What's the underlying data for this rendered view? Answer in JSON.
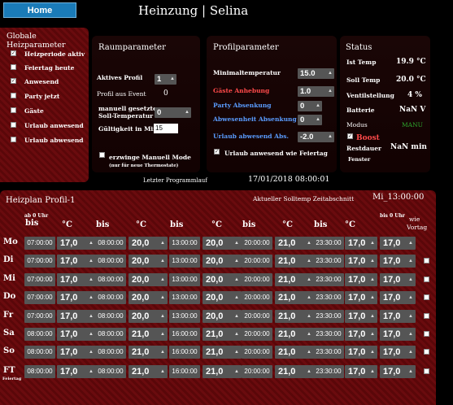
{
  "header": {
    "home_label": "Home",
    "title": "Heinzung | Selina"
  },
  "global": {
    "title": "Globale Heizparameter",
    "items": [
      {
        "label": "Heizperiode aktiv",
        "checked": true
      },
      {
        "label": "Feiertag heute",
        "checked": false
      },
      {
        "label": "Anwesend",
        "checked": true
      },
      {
        "label": "Party jetzt",
        "checked": false
      },
      {
        "label": "Gäste",
        "checked": false
      },
      {
        "label": "Urlaub anwesend",
        "checked": false
      },
      {
        "label": "Urlaub abwesend",
        "checked": false
      }
    ]
  },
  "room": {
    "title": "Raumparameter",
    "active_profile_label": "Aktives Profil",
    "active_profile_value": "1",
    "profile_event_label": "Profil aus Event",
    "profile_event_value": "0",
    "manual_label_1": "manuell gesetzte",
    "manual_label_2": "Soll-Temperatur",
    "manual_value": "0",
    "validity_label": "Gültigkeit in Min",
    "validity_value": "15",
    "force_label": "erzwinge Manuell Mode",
    "force_note": "(nur für neue Thermostate)",
    "last_run_label": "Letzter Programmlauf",
    "last_run_value": "17/01/2018 08:00:01"
  },
  "profile": {
    "title": "Profilparameter",
    "rows": [
      {
        "label": "Minimaltemperatur",
        "value": "15.0",
        "color": "#ffffff"
      },
      {
        "label": "Gäste Anhebung",
        "value": "1.0",
        "color": "#ff4a4a"
      },
      {
        "label": "Party Absenkung",
        "value": "0",
        "color": "#5a9cff"
      },
      {
        "label": "Abwesenheit Absenkung",
        "value": "0",
        "color": "#5a9cff"
      },
      {
        "label": "Urlaub abwesend Abs.",
        "value": "-2.0",
        "color": "#5a9cff"
      }
    ],
    "holiday_label": "Urlaub anwesend wie Feiertag"
  },
  "status": {
    "title": "Status",
    "ist_label": "Ist Temp",
    "ist_value": "19.9 °C",
    "soll_label": "Soll Temp",
    "soll_value": "20.0 °C",
    "ventil_label": "Ventilstellung",
    "ventil_value": "4 %",
    "batterie_label": "Batterie",
    "batterie_value": "NaN V",
    "modus_label": "Modus",
    "modus_value": "MANU",
    "boost_label": "Boost",
    "restdauer_label": "Restdauer",
    "restdauer_value": "NaN min",
    "fenster_label": "Fenster"
  },
  "schedule": {
    "title": "Heizplan Profil-1",
    "current_label": "Aktueller Solltemp Zeitabschnitt",
    "current_value": "Mi_13:00:00",
    "col_bis": "bis",
    "col_temp": "°C",
    "col_ab": "ab 0 Uhr",
    "col_bis0": "bis 0 Uhr",
    "col_wie": "wie",
    "col_vortag": "Vortag",
    "feiertag_small": "Feiertag",
    "days": [
      {
        "name": "Mo",
        "times": [
          "07:00:00",
          "08:00:00",
          "13:00:00",
          "20:00:00",
          "23:30:00"
        ],
        "temps": [
          "17,0",
          "20,0",
          "20,0",
          "21,0",
          "17,0",
          "17,0"
        ]
      },
      {
        "name": "Di",
        "times": [
          "07:00:00",
          "08:00:00",
          "13:00:00",
          "20:00:00",
          "23:30:00"
        ],
        "temps": [
          "17,0",
          "20,0",
          "20,0",
          "21,0",
          "17,0",
          "17,0"
        ]
      },
      {
        "name": "Mi",
        "times": [
          "07:00:00",
          "08:00:00",
          "13:00:00",
          "20:00:00",
          "23:30:00"
        ],
        "temps": [
          "17,0",
          "20,0",
          "20,0",
          "21,0",
          "17,0",
          "17,0"
        ]
      },
      {
        "name": "Do",
        "times": [
          "07:00:00",
          "08:00:00",
          "13:00:00",
          "20:00:00",
          "23:30:00"
        ],
        "temps": [
          "17,0",
          "20,0",
          "20,0",
          "21,0",
          "17,0",
          "17,0"
        ]
      },
      {
        "name": "Fr",
        "times": [
          "07:00:00",
          "08:00:00",
          "13:00:00",
          "20:00:00",
          "23:30:00"
        ],
        "temps": [
          "17,0",
          "20,0",
          "20,0",
          "21,0",
          "17,0",
          "17,0"
        ]
      },
      {
        "name": "Sa",
        "times": [
          "08:00:00",
          "08:00:00",
          "16:00:00",
          "20:00:00",
          "23:30:00"
        ],
        "temps": [
          "17,0",
          "21,0",
          "21,0",
          "21,0",
          "17,0",
          "17,0"
        ]
      },
      {
        "name": "So",
        "times": [
          "08:00:00",
          "08:00:00",
          "16:00:00",
          "20:00:00",
          "23:30:00"
        ],
        "temps": [
          "17,0",
          "21,0",
          "21,0",
          "21,0",
          "17,0",
          "17,0"
        ]
      },
      {
        "name": "FT",
        "times": [
          "08:00:00",
          "08:00:00",
          "16:00:00",
          "20:00:00",
          "23:30:00"
        ],
        "temps": [
          "17,0",
          "21,0",
          "21,0",
          "21,0",
          "17,0",
          "17,0"
        ]
      }
    ]
  },
  "colors": {
    "accent": "#1a7bb8",
    "panel_red": "#6a0b0e",
    "red_text": "#ff4a4a",
    "blue_text": "#5a9cff",
    "green_text": "#2ea82e"
  }
}
